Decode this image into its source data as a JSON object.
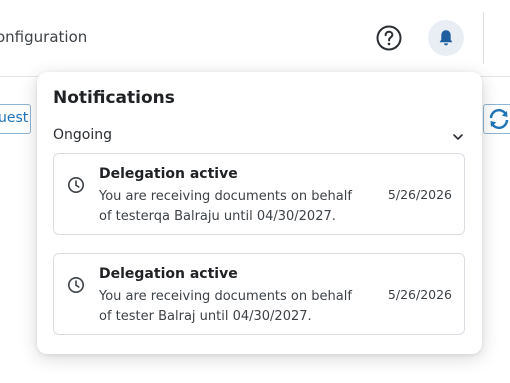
{
  "header": {
    "title": "onfiguration",
    "help_icon": "help-circle-icon",
    "bell_icon": "bell-icon"
  },
  "toolbar": {
    "request_link": "uest",
    "refresh_icon": "refresh-icon"
  },
  "notifications": {
    "title": "Notifications",
    "section_label": "Ongoing",
    "items": [
      {
        "icon": "clock-icon",
        "title": "Delegation active",
        "body": "You are receiving documents on behalf of testerqa Balraju until 04/30/2027.",
        "date": "5/26/2026"
      },
      {
        "icon": "clock-icon",
        "title": "Delegation active",
        "body": "You are receiving documents on behalf of tester Balraj until 04/30/2027.",
        "date": "5/26/2026"
      }
    ]
  },
  "colors": {
    "accent": "#1f74b5",
    "bell_background": "#e9eef5",
    "card_border": "#d9dde2"
  }
}
